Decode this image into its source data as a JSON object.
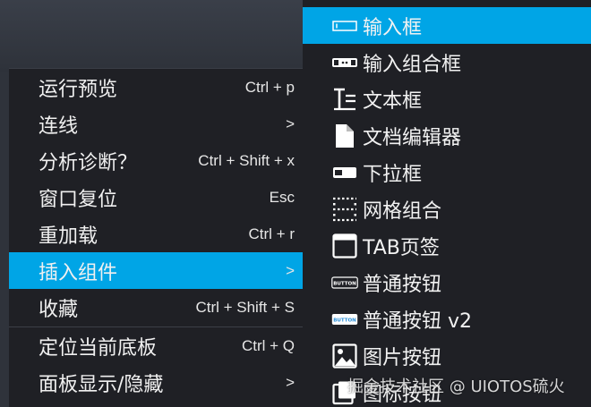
{
  "context_menu": {
    "items": [
      {
        "label": "运行预览",
        "shortcut": "Ctrl + p"
      },
      {
        "label": "连线",
        "shortcut": ">"
      },
      {
        "label": "分析诊断？",
        "shortcut": "Ctrl + Shift + x"
      },
      {
        "label": "窗口复位",
        "shortcut": "Esc"
      },
      {
        "label": "重加载",
        "shortcut": "Ctrl + r"
      },
      {
        "label": "插入组件",
        "shortcut": ">"
      },
      {
        "label": "收藏",
        "shortcut": "Ctrl + Shift + S"
      },
      {
        "label": "定位当前底板",
        "shortcut": "Ctrl + Q"
      },
      {
        "label": "面板显示/隐藏",
        "shortcut": ">"
      }
    ],
    "active_index": 5
  },
  "submenu": {
    "items": [
      {
        "label": "输入框",
        "icon": "input-box-icon"
      },
      {
        "label": "输入组合框",
        "icon": "input-combo-icon"
      },
      {
        "label": "文本框",
        "icon": "text-box-icon"
      },
      {
        "label": "文档编辑器",
        "icon": "document-icon"
      },
      {
        "label": "下拉框",
        "icon": "dropdown-icon"
      },
      {
        "label": "网格组合",
        "icon": "grid-icon"
      },
      {
        "label": "TAB页签",
        "icon": "tab-icon"
      },
      {
        "label": "普通按钮",
        "icon": "button-icon",
        "icon_text": "BUTTON"
      },
      {
        "label": "普通按钮 v2",
        "icon": "button-v2-icon",
        "icon_text": "BUTTON"
      },
      {
        "label": "图片按钮",
        "icon": "image-button-icon"
      },
      {
        "label": "图标按钮",
        "icon": "icon-button-icon"
      }
    ],
    "active_index": 0
  },
  "watermark": "掘金技术社区 @ UIOTOS硫火",
  "colors": {
    "accent": "#00a5e6",
    "menu_bg": "#1f2025",
    "text": "#f0f0f0"
  }
}
